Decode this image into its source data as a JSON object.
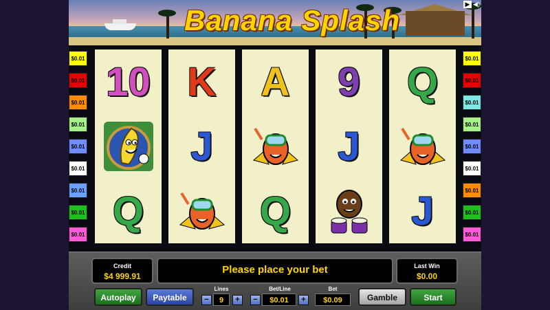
{
  "game": {
    "title": "Banana Splash"
  },
  "top_controls": {
    "play_icon": "play-icon",
    "sound_icon": "sound-icon"
  },
  "line_bets": {
    "left": [
      {
        "label": "$0.01",
        "color": "#ffff00"
      },
      {
        "label": "$0.01",
        "color": "#e60000"
      },
      {
        "label": "$0.01",
        "color": "#ff8c00"
      },
      {
        "label": "$0.01",
        "color": "#a6f08a"
      },
      {
        "label": "$0.01",
        "color": "#6f8cff"
      },
      {
        "label": "$0.01",
        "color": "#ffffff"
      },
      {
        "label": "$0.01",
        "color": "#6aa0ff"
      },
      {
        "label": "$0.01",
        "color": "#1fbf1f"
      },
      {
        "label": "$0.01",
        "color": "#ff5ad8"
      }
    ],
    "right": [
      {
        "label": "$0.01",
        "color": "#ffff00"
      },
      {
        "label": "$0.01",
        "color": "#e60000"
      },
      {
        "label": "$0.01",
        "color": "#7fe6e6"
      },
      {
        "label": "$0.01",
        "color": "#a6f08a"
      },
      {
        "label": "$0.01",
        "color": "#6f8cff"
      },
      {
        "label": "$0.01",
        "color": "#ffffff"
      },
      {
        "label": "$0.01",
        "color": "#ff8c00"
      },
      {
        "label": "$0.01",
        "color": "#1fbf1f"
      },
      {
        "label": "$0.01",
        "color": "#ff5ad8"
      }
    ]
  },
  "reels": [
    [
      "10",
      "banana-character",
      "Q"
    ],
    [
      "K",
      "J",
      "mango-diver-character"
    ],
    [
      "A",
      "mango-diver-character",
      "Q"
    ],
    [
      "9",
      "J",
      "coconut-drummer-character"
    ],
    [
      "Q",
      "mango-diver-character",
      "J"
    ]
  ],
  "panel": {
    "credit_label": "Credit",
    "credit_value": "$4 999.91",
    "message": "Please place your bet",
    "last_win_label": "Last Win",
    "last_win_value": "$0.00",
    "autoplay_label": "Autoplay",
    "paytable_label": "Paytable",
    "lines_label": "Lines",
    "lines_value": "9",
    "betline_label": "Bet/Line",
    "betline_value": "$0.01",
    "bet_label": "Bet",
    "bet_value": "$0.09",
    "gamble_label": "Gamble",
    "start_label": "Start",
    "minus_symbol": "−",
    "plus_symbol": "+"
  }
}
